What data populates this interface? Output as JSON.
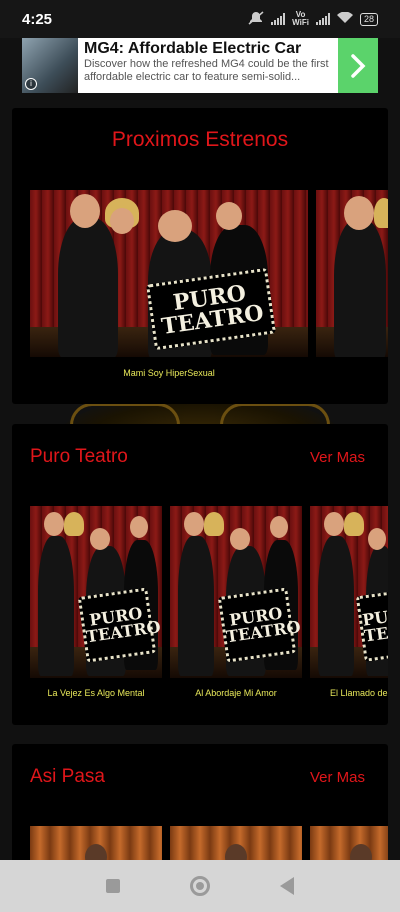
{
  "status_bar": {
    "time": "4:25",
    "network": "Vo\nWiFi",
    "battery": "28"
  },
  "ad": {
    "title": "MG4: Affordable Electric Car",
    "description": "Discover how the refreshed MG4 could be the first affordable electric car to feature semi-solid...",
    "info_icon": "i"
  },
  "featured": {
    "title": "Proximos Estrenos",
    "items": [
      {
        "caption": "Mami Soy HiperSexual",
        "poster_text": [
          "PURO",
          "TEATRO"
        ]
      }
    ]
  },
  "sections": [
    {
      "title": "Puro Teatro",
      "more_label": "Ver Mas",
      "items": [
        {
          "caption": "La Vejez Es Algo Mental",
          "poster_text": [
            "PURO",
            "TEATRO"
          ]
        },
        {
          "caption": "Al Abordaje Mi Amor",
          "poster_text": [
            "PURO",
            "TEATRO"
          ]
        },
        {
          "caption": "El Llamado de",
          "poster_text": [
            "PURO",
            "TEATRO"
          ]
        }
      ]
    },
    {
      "title": "Asi Pasa",
      "more_label": "Ver Mas",
      "items": []
    }
  ],
  "colors": {
    "accent": "#e0161a",
    "caption": "#e8e85a",
    "card_bg": "#000000"
  }
}
